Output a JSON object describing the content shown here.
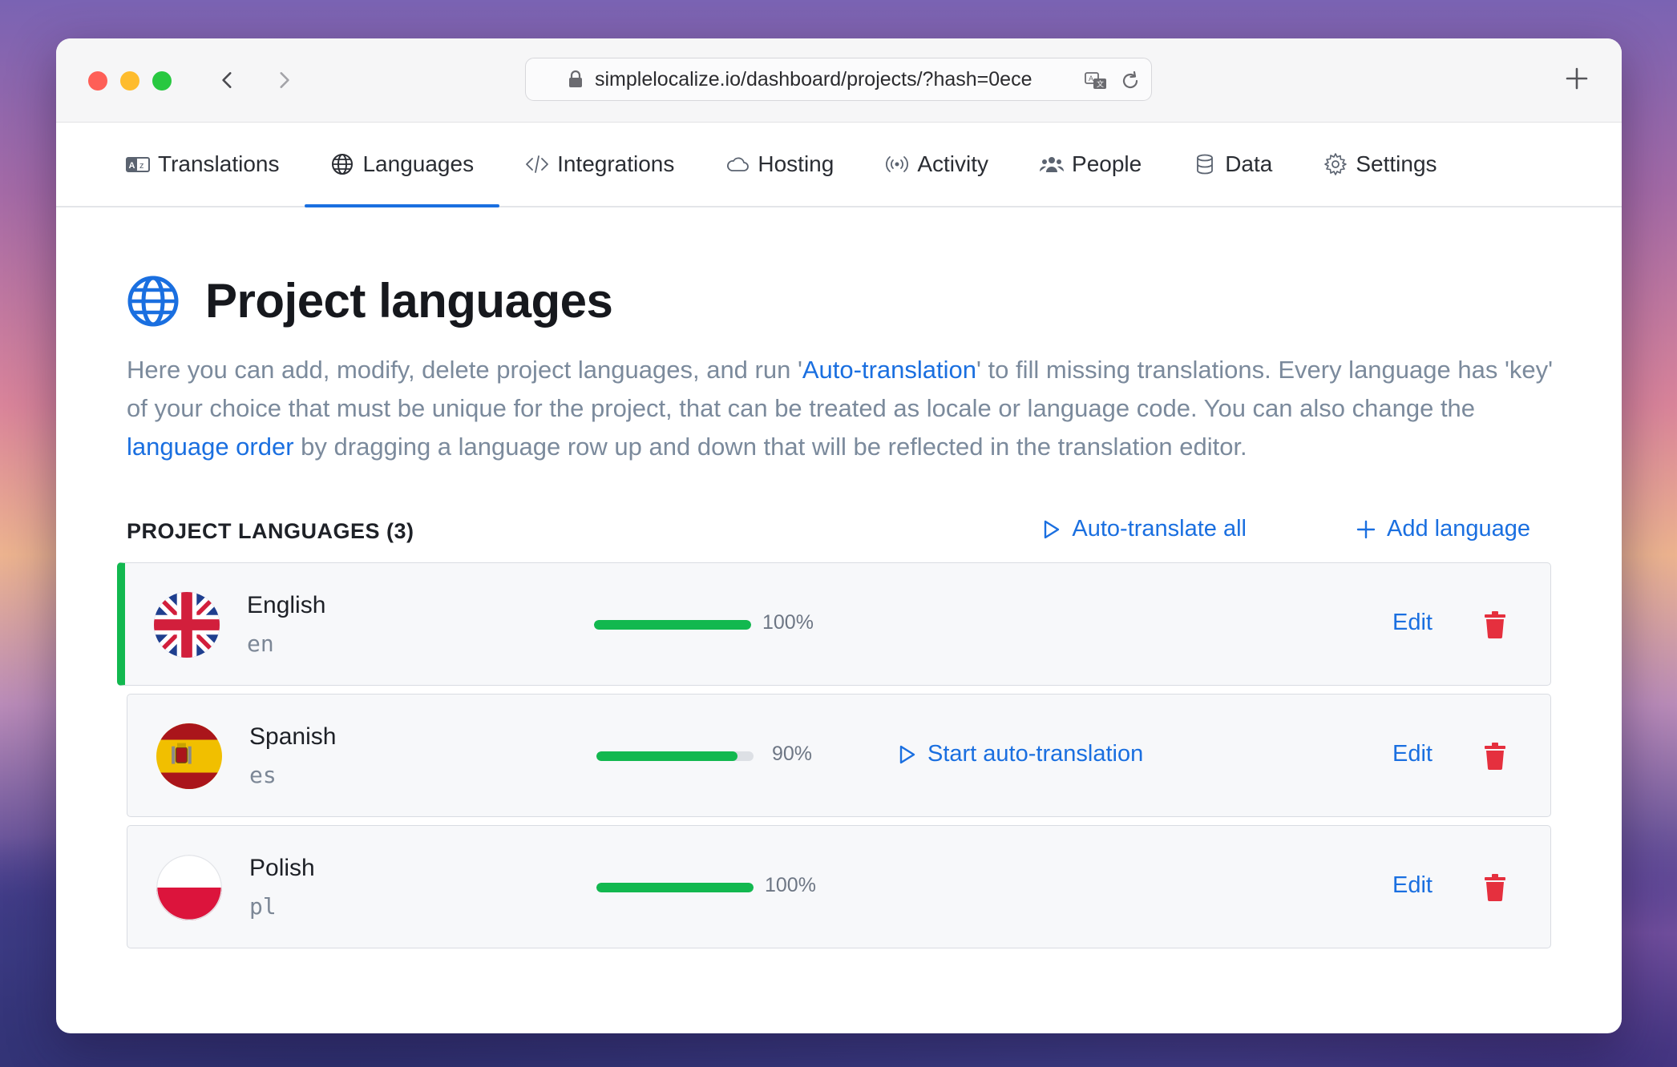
{
  "browser": {
    "url": "simplelocalize.io/dashboard/projects/?hash=0ece"
  },
  "tabs": [
    {
      "label": "Translations",
      "icon": "translate-icon"
    },
    {
      "label": "Languages",
      "icon": "globe-icon",
      "active": true
    },
    {
      "label": "Integrations",
      "icon": "code-icon"
    },
    {
      "label": "Hosting",
      "icon": "cloud-icon"
    },
    {
      "label": "Activity",
      "icon": "broadcast-icon"
    },
    {
      "label": "People",
      "icon": "people-icon"
    },
    {
      "label": "Data",
      "icon": "database-icon"
    },
    {
      "label": "Settings",
      "icon": "gear-icon"
    }
  ],
  "page": {
    "title": "Project languages",
    "description": {
      "part1": "Here you can add, modify, delete project languages, and run '",
      "link1": "Auto-translation",
      "part2": "' to fill missing translations. Every language has 'key' of your choice that must be unique for the project, that can be treated as locale or language code. You can also change the ",
      "link2": "language order",
      "part3": " by dragging a language row up and down that will be reflected in the translation editor."
    }
  },
  "section": {
    "title": "PROJECT LANGUAGES (3)",
    "auto_translate_all": "Auto-translate all",
    "add_language": "Add language"
  },
  "languages": [
    {
      "name": "English",
      "code": "en",
      "progress": 1.0,
      "percent": "100%",
      "flag": "uk-flag"
    },
    {
      "name": "Spanish",
      "code": "es",
      "progress": 0.9,
      "percent": "90%",
      "flag": "spain-flag",
      "action": "Start auto-translation"
    },
    {
      "name": "Polish",
      "code": "pl",
      "progress": 1.0,
      "percent": "100%",
      "flag": "poland-flag"
    }
  ],
  "row_actions": {
    "edit": "Edit"
  },
  "colors": {
    "accent": "#1a6fe0",
    "success": "#12b84f",
    "danger": "#e5303e"
  }
}
